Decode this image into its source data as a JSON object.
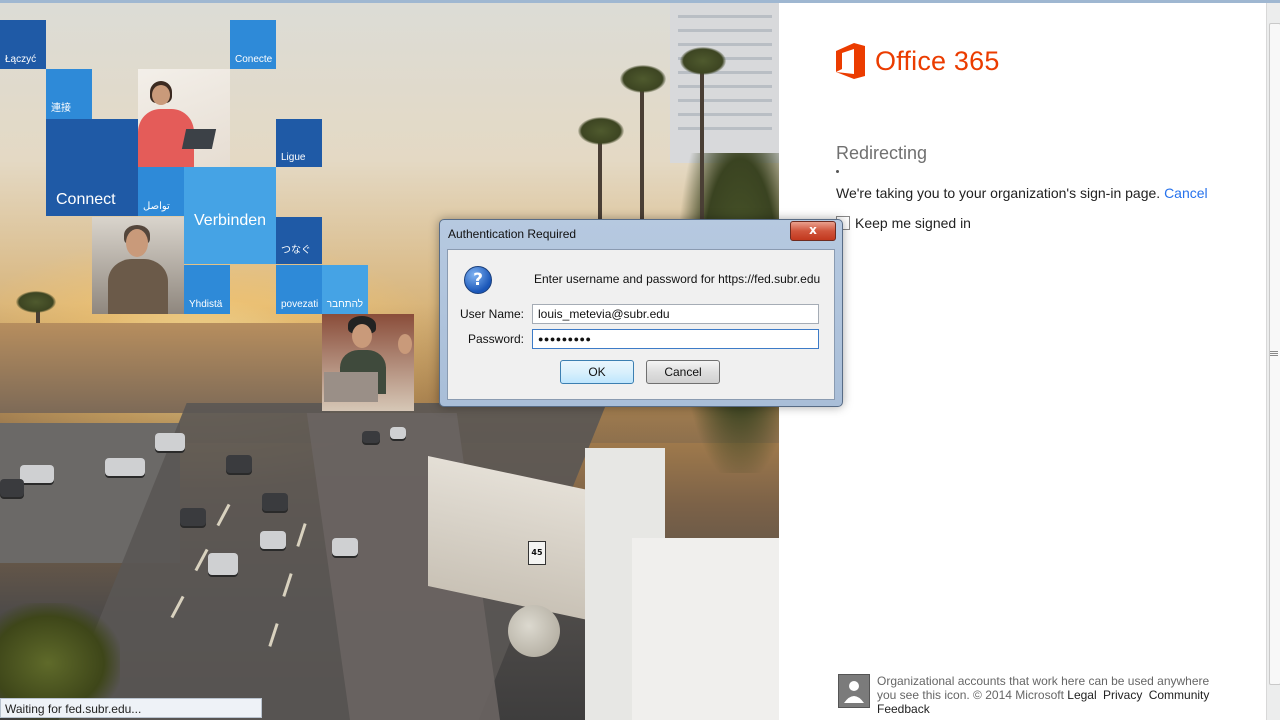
{
  "hero_tiles": {
    "laczyc": "Łączyć",
    "conecte": "Conecte",
    "lianjie": "連接",
    "connect": "Connect",
    "tawasal": "تواصل",
    "ligue": "Ligue",
    "verbinden": "Verbinden",
    "tsunagu": "つなぐ",
    "yhdista": "Yhdistä",
    "povezati": "povezati",
    "lehitchaber": "להתחבר"
  },
  "road_sign": "45",
  "colors": {
    "office_orange": "#eb3c00",
    "link_blue": "#2672ec",
    "tile_blue_dark": "#1f5aa6",
    "tile_blue": "#2e8ad8",
    "tile_blue_light": "#45a3e5"
  },
  "brand": {
    "name": "Office 365",
    "icon": "office-logo-icon"
  },
  "redirect": {
    "title": "Redirecting",
    "message": "We're taking you to your organization's sign-in page.",
    "cancel_link": "Cancel",
    "keep_signed_in": "Keep me signed in"
  },
  "footer": {
    "text": "Organizational accounts that work here can be used anywhere you see this icon. © 2014 Microsoft",
    "links": [
      "Legal",
      "Privacy",
      "Community",
      "Feedback"
    ],
    "icon": "organizational-account-icon"
  },
  "status_bar": "Waiting for fed.subr.edu...",
  "dialog": {
    "title": "Authentication Required",
    "close": "x",
    "icon": "question-icon",
    "message": "Enter username and password for https://fed.subr.edu",
    "username_label": "User Name:",
    "username_value": "louis_metevia@subr.edu",
    "password_label": "Password:",
    "password_value": "●●●●●●●●●",
    "ok": "OK",
    "cancel": "Cancel"
  }
}
